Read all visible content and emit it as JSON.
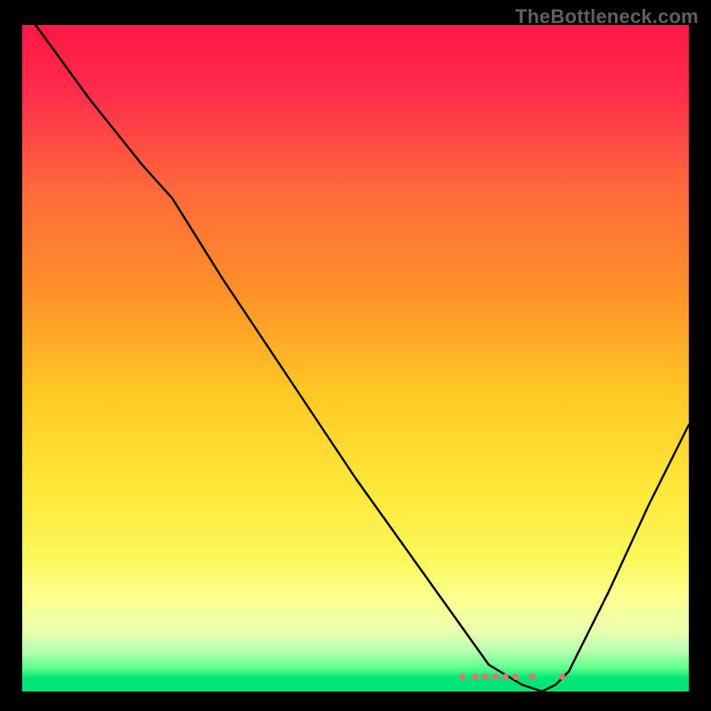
{
  "watermark": "TheBottleneck.com",
  "chart_data": {
    "type": "line",
    "title": "",
    "xlabel": "",
    "ylabel": "",
    "xlim": [
      0,
      100
    ],
    "ylim": [
      0,
      100
    ],
    "gradient_stops": [
      {
        "pct": 0,
        "color": "#ff1744"
      },
      {
        "pct": 10,
        "color": "#ff2c4d"
      },
      {
        "pct": 25,
        "color": "#ff6a3a"
      },
      {
        "pct": 40,
        "color": "#ff9028"
      },
      {
        "pct": 55,
        "color": "#ffc824"
      },
      {
        "pct": 70,
        "color": "#ffe83a"
      },
      {
        "pct": 80,
        "color": "#fbf85a"
      },
      {
        "pct": 86,
        "color": "#fcff90"
      },
      {
        "pct": 91,
        "color": "#e9ffb0"
      },
      {
        "pct": 94,
        "color": "#b6ffb0"
      },
      {
        "pct": 96.5,
        "color": "#5dff8a"
      },
      {
        "pct": 98,
        "color": "#00e676"
      },
      {
        "pct": 100,
        "color": "#00e676"
      }
    ],
    "series": [
      {
        "name": "bottleneck-curve",
        "stroke": "#000000",
        "stroke_width": 2.4,
        "x": [
          2,
          10,
          18,
          22.5,
          30,
          40,
          50,
          60,
          70,
          75,
          78,
          80,
          82,
          88,
          94,
          100
        ],
        "y": [
          100,
          89,
          79,
          74,
          62,
          47,
          32,
          18,
          4,
          1,
          0,
          1,
          3,
          15,
          28,
          40
        ]
      }
    ],
    "markers": {
      "color": "#e57373",
      "radius": 3.6,
      "points": [
        {
          "x": 66,
          "y": 2.2
        },
        {
          "x": 68,
          "y": 2.2
        },
        {
          "x": 69.5,
          "y": 2.2
        },
        {
          "x": 71,
          "y": 2.2
        },
        {
          "x": 72.5,
          "y": 2.2
        },
        {
          "x": 74,
          "y": 2.2
        },
        {
          "x": 76.5,
          "y": 2.2
        },
        {
          "x": 81,
          "y": 2.2
        }
      ]
    }
  }
}
